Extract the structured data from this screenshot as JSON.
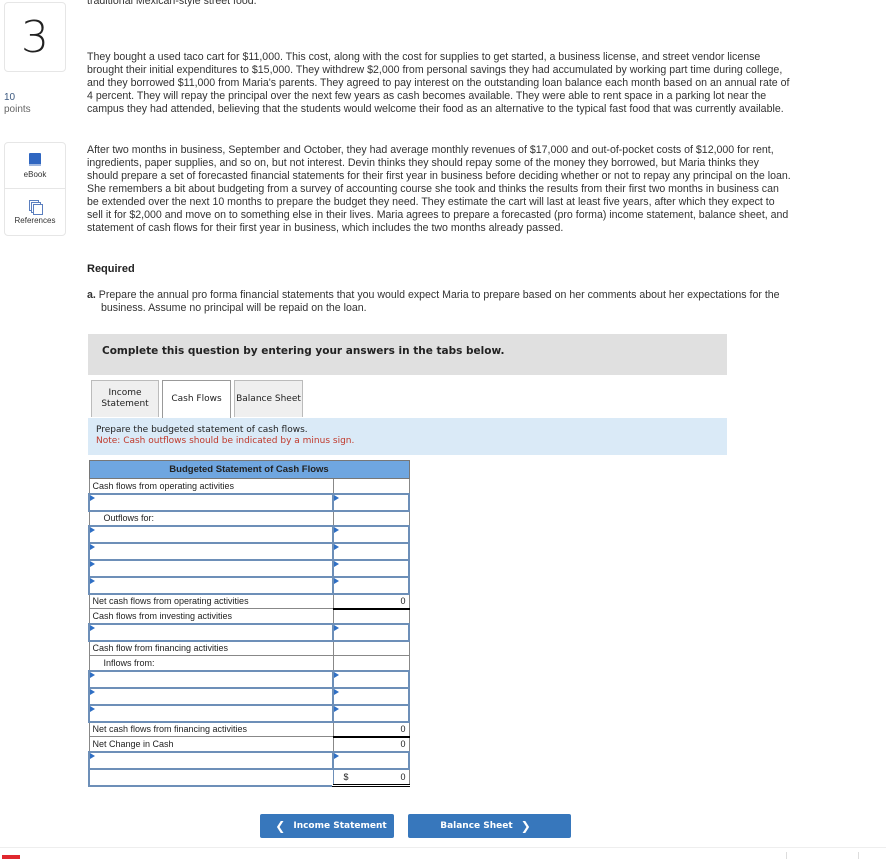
{
  "question": {
    "number": "3",
    "points_value": "10",
    "points_label": "points"
  },
  "side_tools": [
    {
      "label": "eBook",
      "icon": "book-icon"
    },
    {
      "label": "References",
      "icon": "references-icon"
    }
  ],
  "problem": {
    "cut_line": "traditional Mexican-style street food.",
    "paragraph1": "They bought a used taco cart for $11,000. This cost, along with the cost for supplies to get started, a business license, and street vendor license brought their initial expenditures to $15,000. They withdrew $2,000 from personal savings they had accumulated by working part time during college, and they borrowed $11,000 from Maria's parents. They agreed to pay interest on the outstanding loan balance each month based on an annual rate of 4 percent. They will repay the principal over the next few years as cash becomes available. They were able to rent space in a parking lot near the campus they had attended, believing that the students would welcome their food as an alternative to the typical fast food that was currently available.",
    "paragraph2": "After two months in business, September and October, they had average monthly revenues of $17,000 and out-of-pocket costs of $12,000 for rent, ingredients, paper supplies, and so on, but not interest. Devin thinks they should repay some of the money they borrowed, but Maria thinks they should prepare a set of forecasted financial statements for their first year in business before deciding whether or not to repay any principal on the loan. She remembers a bit about budgeting from a survey of accounting course she took and thinks the results from their first two months in business can be extended over the next 10 months to prepare the budget they need. They estimate the cart will last at least five years, after which they expect to sell it for $2,000 and move on to something else in their lives. Maria agrees to prepare a forecasted (pro forma) income statement, balance sheet, and statement of cash flows for their first year in business, which includes the two months already passed.",
    "required_heading": "Required",
    "required_a_marker": "a.",
    "required_a_text": "Prepare the annual pro forma financial statements that you would expect Maria to prepare based on her comments about her expectations for the business. Assume no principal will be repaid on the loan."
  },
  "instructions_banner": "Complete this question by entering your answers in the tabs below.",
  "tabs": [
    {
      "label": "Income Statement",
      "active": false
    },
    {
      "label": "Cash Flows",
      "active": true
    },
    {
      "label": "Balance Sheet",
      "active": false
    }
  ],
  "info": {
    "prompt": "Prepare the budgeted statement of cash flows.",
    "note": "Note: Cash outflows should be indicated by a minus sign."
  },
  "statement": {
    "title": "Budgeted Statement of Cash Flows",
    "rows": {
      "operating_header": "Cash flows from operating activities",
      "outflows_for": "Outflows for:",
      "net_operating_label": "Net cash flows from operating activities",
      "net_operating_value": "0",
      "investing_header": "Cash flows from investing activities",
      "financing_header": "Cash flow from financing activities",
      "inflows_from": "Inflows from:",
      "net_financing_label": "Net cash flows from financing activities",
      "net_financing_value": "0",
      "net_change_label": "Net Change in Cash",
      "net_change_value": "0",
      "ending_currency": "$",
      "ending_value": "0"
    }
  },
  "nav": {
    "prev_label": "Income Statement",
    "next_label": "Balance Sheet"
  },
  "colors": {
    "accent": "#3777bc",
    "table_header": "#6fa6e0",
    "info_bg": "#daeaf7",
    "note_red": "#c0392b"
  }
}
